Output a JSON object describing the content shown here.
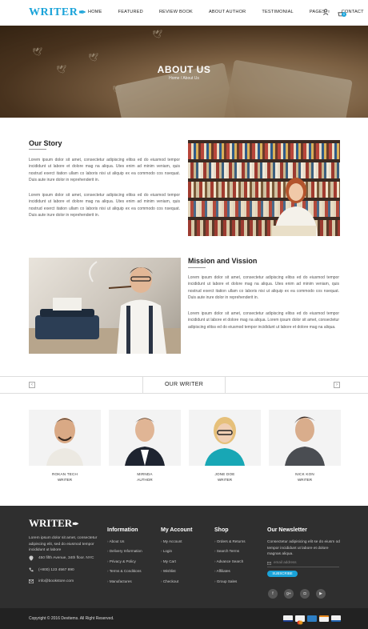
{
  "header": {
    "logo": "WRITER",
    "nav": [
      "HOME",
      "FEATURED",
      "REVIEW BOOK",
      "ABOUT AUTHOR",
      "TESTIMONIAL",
      "PAGES",
      "CONTACT"
    ],
    "cart_count": "0"
  },
  "hero": {
    "title": "ABOUT US",
    "breadcrumb": "Home / About Us"
  },
  "story": {
    "title": "Our Story",
    "p1": "Lorem ipsum dolor sit amet, consectetur adipiscing elitss ed do eiusmod tempor incididunt ut labore et dolore mag na aliqua. Utes enim ad minim veniam, quis nostrud exerct itation ullam co laboris nisi ut aliquip ex ea commodo cos nsequat. Duis aute irure dolor in reprehenderit in.",
    "p2": "Lorem ipsum dolor sit amet, consectetur adipiscing elitss ed do eiusmod tempor incididunt ut labore et dolore mag na aliqua. Utes enim ad minim veniam, quis nostrud exerct itation ullam co laboris nisi ut aliquip ex ea commodo cos nsequat. Duis aute irure dolor in reprehenderit in."
  },
  "mission": {
    "title": "Mission and Vission",
    "p1": "Lorem ipsum dolor sit amet, consectetur adipiscing elitss ed do eiusmod tempor incididunt ut labore et dolore mag na aliqua. Utes enim ad minim veniam, quis nostrud exerct itation ullam co laboris nisi ut aliquip ex ea commodo cos nsequat. Duis aute irure dolor in reprehenderit in.",
    "p2": "Lorem ipsum dolor sit amet, consectetur adipiscing elitss ed do eiusmod tempor incididunt ut labore et dolore mag na aliqua. Lorem ipsum dolor sit amet, consectetur adipiscing elitss ed do eiusmod tempor incididunt ut labore et dolore mag na aliqua."
  },
  "writers": {
    "title": "OUR WRITER",
    "items": [
      {
        "name": "ROKAN TECH",
        "role": "WRITER"
      },
      {
        "name": "MIRNDA",
        "role": "AUTHOR"
      },
      {
        "name": "JONE DOE",
        "role": "WRITER"
      },
      {
        "name": "NICK KON",
        "role": "WRITER"
      }
    ]
  },
  "footer": {
    "logo": "WRITER",
    "about": "Lorem ipsum dolor sit amet, consectetur adipiscing elit, sed do eiusmod tempor incididunt ut labore",
    "address": "450 fifth Avenue, 34th floor. NYC",
    "phone": "(+800) 123 4567 890",
    "email": "info@bookstore.com",
    "information": {
      "title": "Information",
      "items": [
        "About Us",
        "Delivery Information",
        "Privacy & Policy",
        "Terms & Conditions",
        "Manufactures"
      ]
    },
    "account": {
      "title": "My Account",
      "items": [
        "My Account",
        "Login",
        "My Cart",
        "Wishlist",
        "Checkout"
      ]
    },
    "shop": {
      "title": "Shop",
      "items": [
        "Orders & Returns",
        "Search Terms",
        "Advance Search",
        "Affiliates",
        "Group Sales"
      ]
    },
    "newsletter": {
      "title": "Our Newsletter",
      "text": "Consectetur adipisicing elit se do eiusm od tempor incididunt ut labore et dolore magnas aliqua.",
      "placeholder": "email address",
      "button": "SUBSCRIBE"
    },
    "social_icons": [
      "facebook-icon",
      "google-plus-icon",
      "instagram-icon",
      "youtube-icon"
    ],
    "copyright": "Copyright © 2016 Devitems. All Right Reserved.",
    "payments": [
      "visa",
      "mastercard",
      "amex",
      "discover",
      "paypal"
    ]
  },
  "colors": {
    "accent": "#1aa3d9",
    "footer_bg": "#2f2f2f",
    "bottom_bar": "#222222"
  }
}
